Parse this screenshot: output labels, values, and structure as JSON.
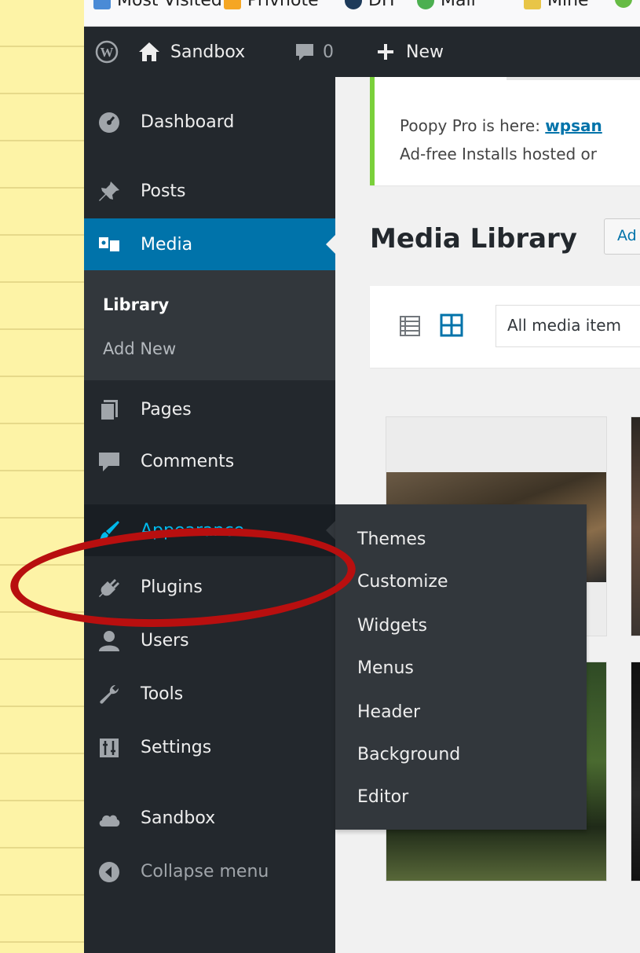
{
  "browser": {
    "bookmarks": [
      {
        "label": "Most Visited",
        "icon": "gear-favicon",
        "color": "#4a8bd6"
      },
      {
        "label": "Privnote",
        "icon": "privnote-favicon",
        "color": "#f5a623"
      },
      {
        "label": "DH",
        "icon": "dh-favicon",
        "color": "#1e3b5a"
      },
      {
        "label": "Mail",
        "icon": "mail-favicon",
        "color": "#4caf50"
      },
      {
        "label": "Mine",
        "icon": "folder-favicon",
        "color": "#e8c547"
      }
    ]
  },
  "admin_bar": {
    "wp_logo": "wordpress-logo-icon",
    "site_name": "Sandbox",
    "comments_count": "0",
    "new_label": "New"
  },
  "sidebar": {
    "items": [
      {
        "label": "Dashboard",
        "icon": "dashboard-icon"
      },
      {
        "label": "Posts",
        "icon": "pin-icon"
      },
      {
        "label": "Media",
        "icon": "media-icon",
        "state": "current"
      },
      {
        "label": "Pages",
        "icon": "pages-icon"
      },
      {
        "label": "Comments",
        "icon": "comment-icon"
      },
      {
        "label": "Appearance",
        "icon": "brush-icon",
        "state": "hover"
      },
      {
        "label": "Plugins",
        "icon": "plugin-icon"
      },
      {
        "label": "Users",
        "icon": "users-icon"
      },
      {
        "label": "Tools",
        "icon": "wrench-icon"
      },
      {
        "label": "Settings",
        "icon": "settings-icon"
      },
      {
        "label": "Sandbox",
        "icon": "cloud-icon"
      },
      {
        "label": "Collapse menu",
        "icon": "collapse-icon"
      }
    ],
    "media_submenu": [
      {
        "label": "Library",
        "active": true
      },
      {
        "label": "Add New",
        "active": false
      }
    ]
  },
  "appearance_flyout": {
    "items": [
      "Themes",
      "Customize",
      "Widgets",
      "Menus",
      "Header",
      "Background",
      "Editor"
    ]
  },
  "notice": {
    "line1_prefix": "Poopy Pro is here: ",
    "line1_link": "wpsan",
    "line2": "Ad-free Installs hosted or"
  },
  "main": {
    "title": "Media Library",
    "add_new_label": "Ad",
    "filter_value": "All media item"
  },
  "colors": {
    "sidebar_bg": "#23282d",
    "current_bg": "#0073aa",
    "hover_text": "#00b9eb",
    "notice_border": "#7ad03a",
    "annotation_red": "#b80f0f"
  }
}
